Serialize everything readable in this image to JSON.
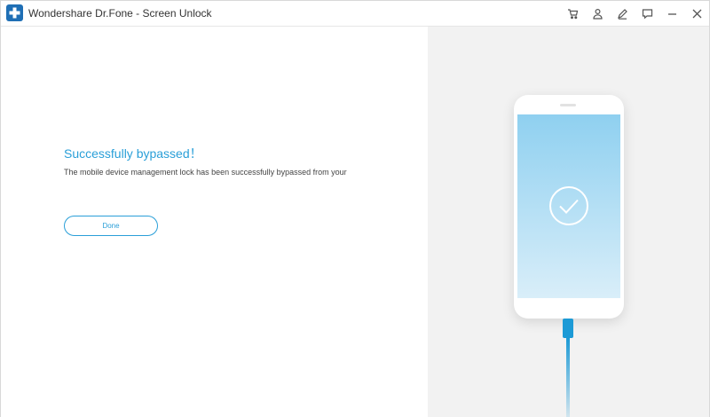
{
  "window": {
    "title": "Wondershare Dr.Fone - Screen Unlock"
  },
  "toolbar_icons": [
    "cart-icon",
    "user-icon",
    "edit-icon",
    "feedback-icon",
    "minimize-icon",
    "close-icon"
  ],
  "content": {
    "title": "Successfully bypassed！",
    "description": "The mobile device management lock has been successfully bypassed from your",
    "done_label": "Done"
  },
  "colors": {
    "accent": "#2a9fd8",
    "logo": "#1f6fb5",
    "cable": "#1c9ad6",
    "right_panel_bg": "#f2f2f2"
  }
}
